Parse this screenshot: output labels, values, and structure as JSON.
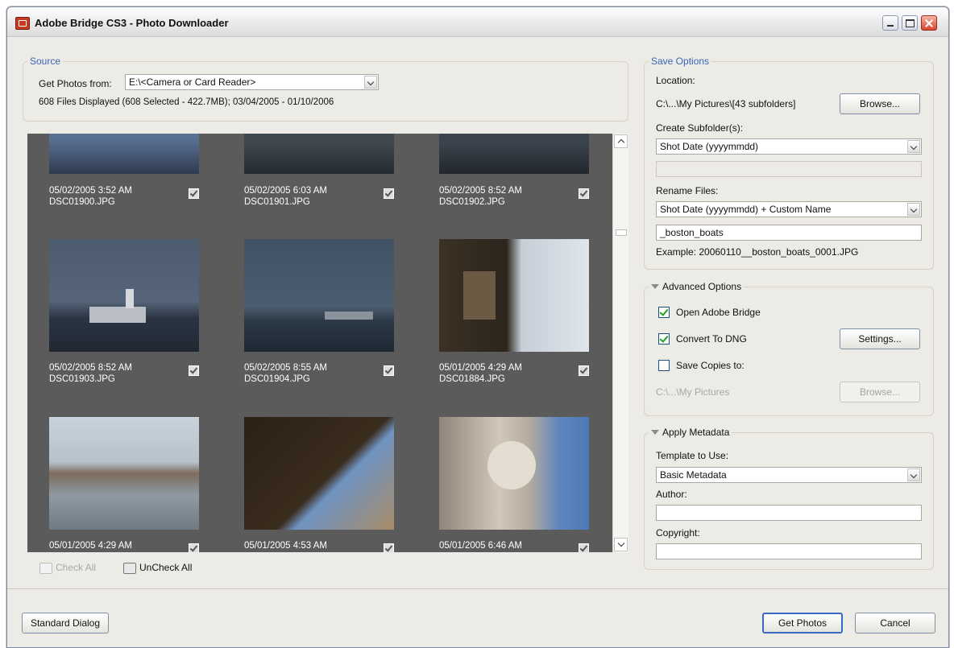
{
  "window": {
    "title": "Adobe Bridge CS3 - Photo Downloader"
  },
  "source": {
    "legend": "Source",
    "get_photos_label": "Get Photos from:",
    "get_photos_value": "E:\\<Camera or Card Reader>",
    "files_info": "608 Files Displayed (608 Selected - 422.7MB); 03/04/2005 - 01/10/2006"
  },
  "thumbnails": [
    {
      "datetime": "05/02/2005 3:52 AM",
      "filename": "DSC01900.JPG",
      "checked": true
    },
    {
      "datetime": "05/02/2005 6:03 AM",
      "filename": "DSC01901.JPG",
      "checked": true
    },
    {
      "datetime": "05/02/2005 8:52 AM",
      "filename": "DSC01902.JPG",
      "checked": true
    },
    {
      "datetime": "05/02/2005 8:52 AM",
      "filename": "DSC01903.JPG",
      "checked": true
    },
    {
      "datetime": "05/02/2005 8:55 AM",
      "filename": "DSC01904.JPG",
      "checked": true
    },
    {
      "datetime": "05/01/2005 4:29 AM",
      "filename": "DSC01884.JPG",
      "checked": true
    },
    {
      "datetime": "05/01/2005 4:29 AM",
      "filename": "",
      "checked": true
    },
    {
      "datetime": "05/01/2005 4:53 AM",
      "filename": "",
      "checked": true
    },
    {
      "datetime": "05/01/2005 6:46 AM",
      "filename": "",
      "checked": true
    }
  ],
  "gallery_actions": {
    "check_all": "Check All",
    "uncheck_all": "UnCheck All"
  },
  "save_options": {
    "legend": "Save Options",
    "location_label": "Location:",
    "location_value": "C:\\...\\My Pictures\\[43 subfolders]",
    "browse_label": "Browse...",
    "subfolder_label": "Create Subfolder(s):",
    "subfolder_value": "Shot Date (yyyymmdd)",
    "subfolder_custom": "",
    "rename_label": "Rename Files:",
    "rename_value": "Shot Date (yyyymmdd) + Custom Name",
    "custom_name": "_boston_boats",
    "example": "Example:  20060110__boston_boats_0001.JPG"
  },
  "advanced_options": {
    "legend": "Advanced Options",
    "open_bridge": "Open Adobe Bridge",
    "open_bridge_checked": true,
    "convert_dng": "Convert To DNG",
    "convert_dng_checked": true,
    "settings_label": "Settings...",
    "save_copies": "Save Copies to:",
    "save_copies_checked": false,
    "save_copies_path": "C:\\...\\My Pictures",
    "browse_label": "Browse..."
  },
  "apply_metadata": {
    "legend": "Apply Metadata",
    "template_label": "Template to Use:",
    "template_value": "Basic Metadata",
    "author_label": "Author:",
    "author_value": "",
    "copyright_label": "Copyright:",
    "copyright_value": ""
  },
  "footer": {
    "standard_dialog": "Standard Dialog",
    "get_photos": "Get Photos",
    "cancel": "Cancel"
  }
}
